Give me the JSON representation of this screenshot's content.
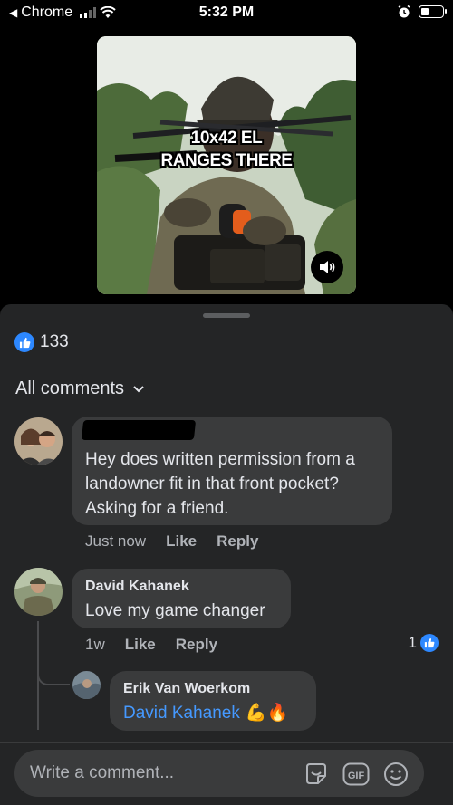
{
  "status_bar": {
    "back_app": "Chrome",
    "time": "5:32 PM"
  },
  "video": {
    "caption_line1": "10x42 EL",
    "caption_line2": "RANGES THERE"
  },
  "reactions": {
    "count": "133"
  },
  "comments_header": {
    "label": "All comments"
  },
  "comments": [
    {
      "name": "",
      "text_line1": "Hey does written permission from a",
      "text_line2": "landowner fit in that front pocket?",
      "text_line3": "Asking for a friend.",
      "time": "Just now",
      "like_label": "Like",
      "reply_label": "Reply"
    },
    {
      "name": "David Kahanek",
      "text": "Love my game changer",
      "time": "1w",
      "like_label": "Like",
      "reply_label": "Reply",
      "like_count": "1"
    },
    {
      "name": "Erik Van Woerkom",
      "mention": "David Kahanek",
      "emoji": "💪🔥"
    }
  ],
  "composer": {
    "placeholder": "Write a comment..."
  },
  "colors": {
    "sheet_bg": "#242526",
    "bubble_bg": "#3a3b3c",
    "accent_blue": "#2d88ff",
    "mention_blue": "#4599ff",
    "muted_text": "#b0b3b8"
  }
}
